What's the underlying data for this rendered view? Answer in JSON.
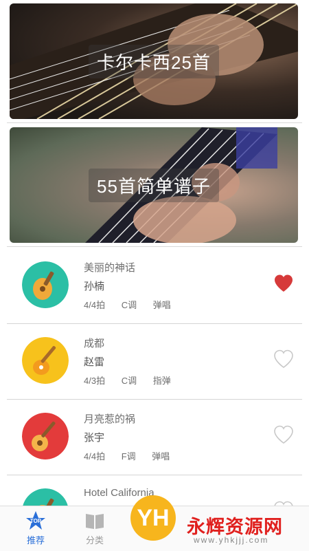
{
  "banners": [
    {
      "title": "卡尔卡西25首"
    },
    {
      "title": "55首简单谱子"
    }
  ],
  "songs": [
    {
      "title": "美丽的神话",
      "artist": "孙楠",
      "beat": "4/4拍",
      "key": "C调",
      "style": "弹唱",
      "favorited": true,
      "thumb_color": "#2bbfa5"
    },
    {
      "title": "成都",
      "artist": "赵雷",
      "beat": "4/3拍",
      "key": "C调",
      "style": "指弹",
      "favorited": false,
      "thumb_color": "#f7c21c"
    },
    {
      "title": "月亮惹的祸",
      "artist": "张宇",
      "beat": "4/4拍",
      "key": "F调",
      "style": "弹唱",
      "favorited": false,
      "thumb_color": "#e33b3b"
    },
    {
      "title": "Hotel California",
      "artist": "",
      "beat": "",
      "key": "",
      "style": "",
      "favorited": false,
      "thumb_color": "#2bbfa5"
    }
  ],
  "tabs": [
    {
      "label": "推荐",
      "icon": "top-star-icon",
      "active": true
    },
    {
      "label": "分类",
      "icon": "book-icon",
      "active": false
    }
  ],
  "watermark": {
    "logo": "YH",
    "title": "永辉资源网",
    "url": "www.yhkjjj.com"
  },
  "colors": {
    "accent": "#2a6fd8",
    "heart": "#d63a3a",
    "heart_outline": "#c8c8c8"
  }
}
